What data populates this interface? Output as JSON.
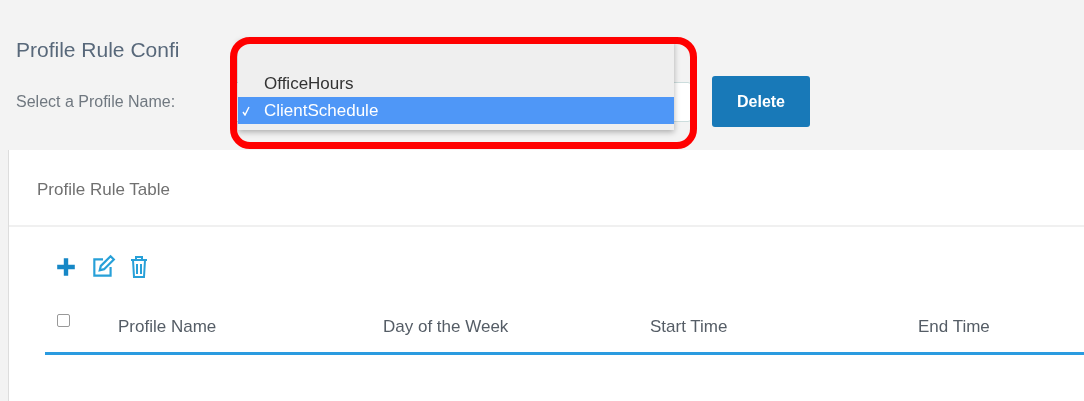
{
  "page": {
    "title": "Profile Rule Confi"
  },
  "profile_select": {
    "label": "Select a Profile Name:",
    "options": [
      {
        "label": "OfficeHours",
        "selected": false
      },
      {
        "label": "ClientSchedule",
        "selected": true
      }
    ],
    "expanded": true,
    "highlighted": true
  },
  "delete_button": "Delete",
  "panel": {
    "title": "Profile Rule Table"
  },
  "toolbar": [
    {
      "kind": "add"
    },
    {
      "kind": "edit"
    },
    {
      "kind": "delete"
    }
  ],
  "table": {
    "select_all_checked": false,
    "columns": [
      "Profile Name",
      "Day of the Week",
      "Start Time",
      "End Time"
    ]
  }
}
